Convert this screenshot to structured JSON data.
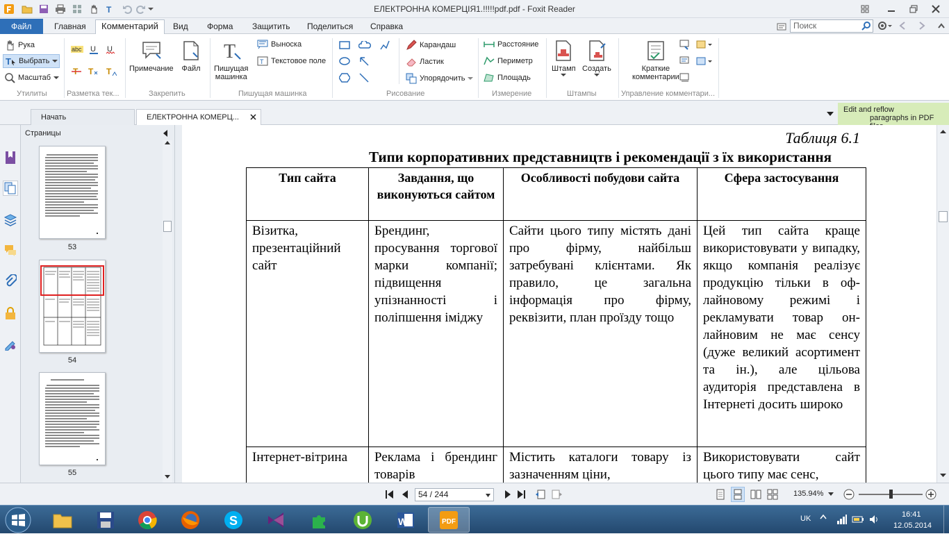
{
  "window": {
    "title": "ЕЛЕКТРОННА КОМЕРЦІЯ1.!!!!!pdf.pdf - Foxit Reader"
  },
  "menu": {
    "file": "Файл",
    "tabs": [
      "Главная",
      "Комментарий",
      "Вид",
      "Форма",
      "Защитить",
      "Поделиться",
      "Справка"
    ],
    "active_tab": "Комментарий",
    "search_placeholder": "Поиск"
  },
  "ribbon": {
    "utilities": {
      "hand": "Рука",
      "select": "Выбрать",
      "zoom": "Масштаб",
      "label": "Утилиты"
    },
    "markup_label": "Разметка тек...",
    "pin": {
      "note": "Примечание",
      "file": "Файл",
      "label": "Закрепить"
    },
    "typewriter": {
      "tool_line1": "Пишущая",
      "tool_line2": "машинка",
      "callout": "Выноска",
      "textbox": "Текстовое поле",
      "label": "Пишущая машинка"
    },
    "drawing": {
      "pencil": "Карандаш",
      "eraser": "Ластик",
      "arrange": "Упорядочить",
      "label": "Рисование"
    },
    "measure": {
      "distance": "Расстояние",
      "perimeter": "Периметр",
      "area": "Площадь",
      "label": "Измерение"
    },
    "stamps": {
      "stamp": "Штамп",
      "create": "Создать",
      "label": "Штампы"
    },
    "manage": {
      "summary_line1": "Краткие",
      "summary_line2": "комментарии",
      "label": "Управление комментари..."
    }
  },
  "tabs": {
    "start": "Начать",
    "doc": "ЕЛЕКТРОННА КОМЕРЦ...",
    "promo_line1": "Edit and reflow",
    "promo_line2": "paragraphs in PDF files"
  },
  "panel": {
    "title": "Страницы",
    "thumbs": [
      "53",
      "54",
      "55"
    ]
  },
  "document": {
    "caption": "Таблиця 6.1",
    "title": "Типи корпоративних представництв і рекомендації з їх використання",
    "headers": [
      "Тип сайта",
      "Завдання, що виконуються сайтом",
      "Особливості побудови сайта",
      "Сфера застосування"
    ],
    "rows": [
      [
        "Візитка, презентаційний сайт",
        "Брендинг, просування торгової марки компанії; підвищення упізнанності і поліпшення іміджу",
        "Сайти цього типу містять дані про фірму, найбільш затребувані клієнтами. Як правило, це загальна інформація про фірму, реквізити, план проїзду тощо",
        "Цей тип сайта краще використовувати у випадку, якщо компанія реалізує продукцію тільки в оф-лайновому режимі і рекламувати товар он-лайновим не має сенсу (дуже великий асортимент та ін.), але цільова аудиторія представлена в Інтернеті досить широко"
      ],
      [
        "Інтернет-вітрина",
        "Реклама і брендинг товарів",
        "Містить каталоги товару із зазначенням ціни,",
        "Використовувати сайт цього типу має сенс,"
      ]
    ]
  },
  "status": {
    "page": "54 / 244",
    "zoom": "135.94%"
  },
  "taskbar": {
    "lang": "UK",
    "time": "16:41",
    "date": "12.05.2014"
  }
}
